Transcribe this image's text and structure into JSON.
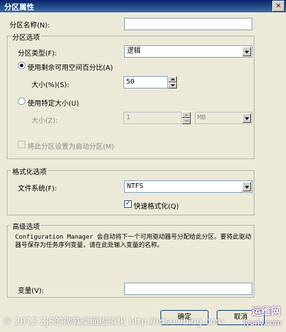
{
  "window": {
    "title": "分区属性",
    "close_glyph": "×"
  },
  "partition_name": {
    "label": "分区名称(N):",
    "value": ""
  },
  "partition_options": {
    "group_label": "分区选项",
    "type_label": "分区类型(F):",
    "type_value": "逻辑",
    "radio_remaining": {
      "label": "使用剩余可用空间百分比(A)",
      "checked": true
    },
    "size_percent_label": "大小(%)(S):",
    "size_percent_value": "50",
    "radio_specific": {
      "label": "使用特定大小(U)",
      "checked": false
    },
    "size_label": "大小(Z):",
    "size_value": "1",
    "unit_value": "MB",
    "boot_checkbox": {
      "label": "将此分区设置为启动分区(M)",
      "checked": false
    }
  },
  "format_options": {
    "group_label": "格式化选项",
    "fs_label": "文件系统(F):",
    "fs_value": "NTFS",
    "quick_format": {
      "label": "快速格式化(Q)",
      "checked": true,
      "check_glyph": "✓"
    }
  },
  "advanced_options": {
    "group_label": "高级选项",
    "description": "Configuration Manager 会自动将下一个可用驱动器号分配给此分区。要将此驱动器号保存为任务序列变量，请在此处输入变量的名称。",
    "variable_label": "变量(V):",
    "variable_value": ""
  },
  "buttons": {
    "ok": "确定",
    "cancel": "取消"
  },
  "watermark": {
    "text": "© 2012 ZJS的微软桌面虚拟化 http://rdsoviblog.com",
    "logo_text": "运维网",
    "logo_url": "iyunv.com",
    "logo_color": "#7a2bbf"
  }
}
